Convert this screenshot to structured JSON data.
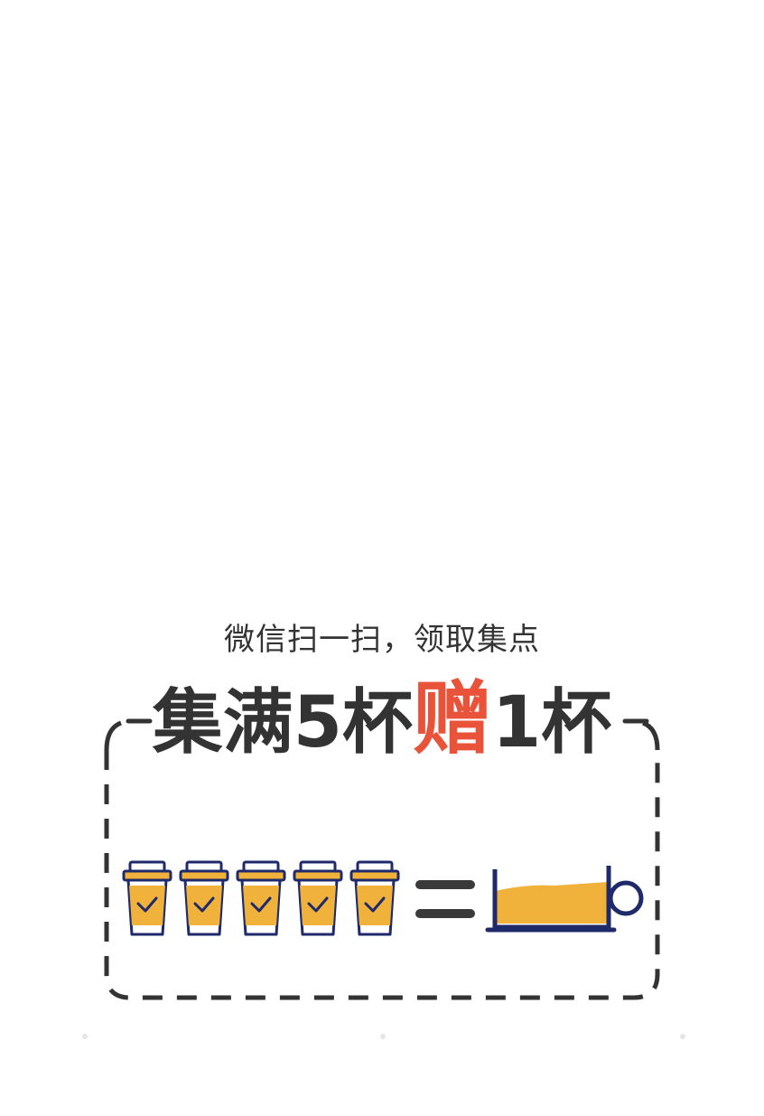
{
  "promo": {
    "subtitle": "微信扫一扫，领取集点",
    "headline_part1": "集满5杯",
    "headline_accent": "赠",
    "headline_part2": "1杯"
  },
  "stamps": {
    "filled_count": 5,
    "total_required": 5,
    "reward_count": 1
  },
  "icons": {
    "stamp_cup": "coffee-cup-check-icon",
    "equals": "equals-icon",
    "reward_cup": "coffee-mug-icon"
  },
  "colors": {
    "text_dark": "#333333",
    "accent_red": "#e8533a",
    "cup_yellow": "#f0b23a",
    "cup_navy": "#1f2a6b",
    "frame_dash": "#333333"
  }
}
